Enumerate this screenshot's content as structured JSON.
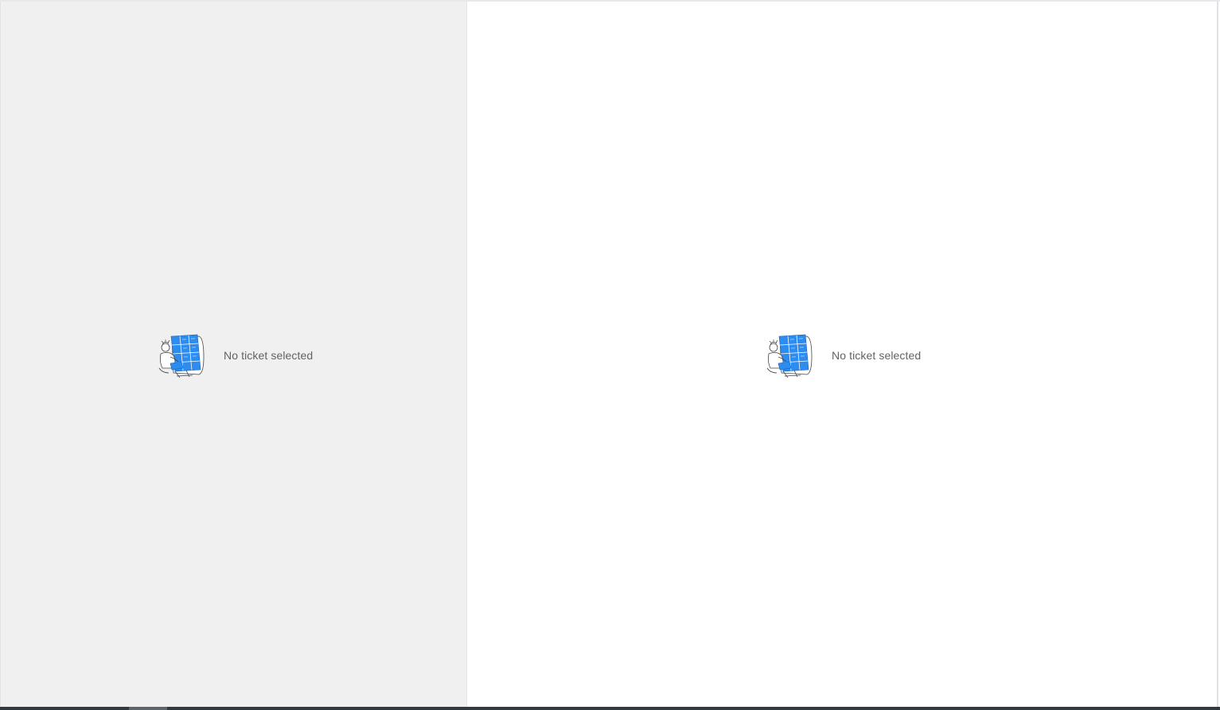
{
  "left_panel": {
    "empty_message": "No ticket selected",
    "illustration_icon": "person-at-screen-illustration"
  },
  "right_panel": {
    "empty_message": "No ticket selected",
    "illustration_icon": "person-at-screen-illustration"
  },
  "colors": {
    "accent": "#2d8cf0",
    "left_bg": "#f0f0f0",
    "right_bg": "#ffffff",
    "text": "#5f6368"
  }
}
